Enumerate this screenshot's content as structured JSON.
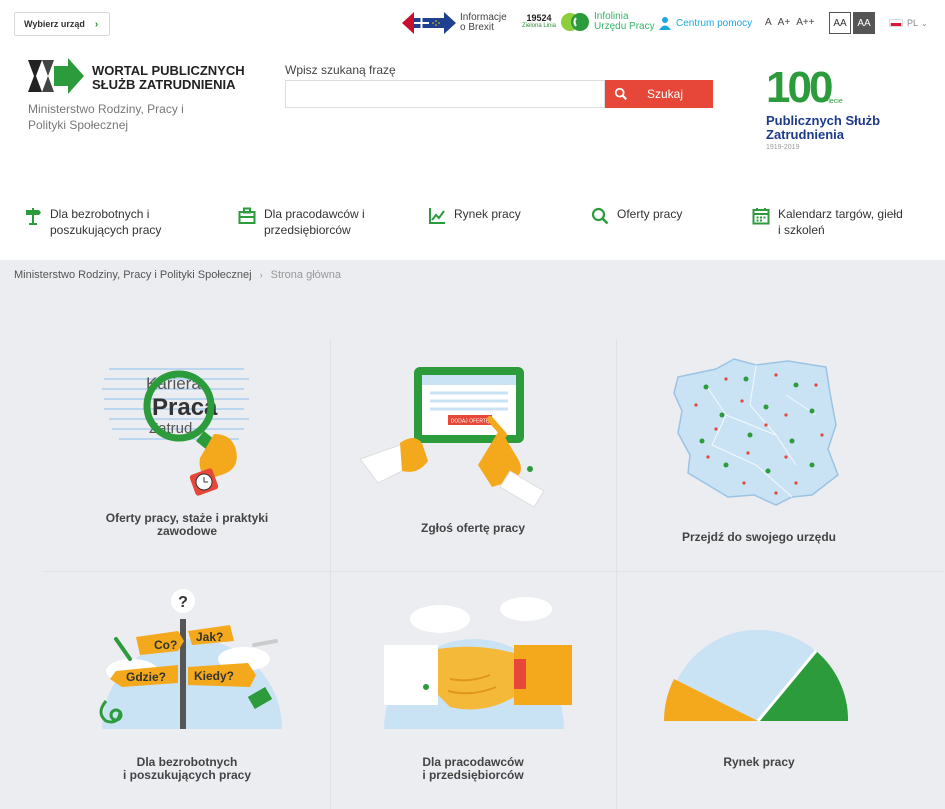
{
  "topbar": {
    "choose_office": "Wybierz urząd",
    "brexit_line1": "Informacje",
    "brexit_line2": "o Brexit",
    "infolinia_number": "19524",
    "infolinia_sub": "Zielona Linia",
    "infolinia_line1": "Infolinia",
    "infolinia_line2": "Urzędu Pracy",
    "help": "Centrum pomocy",
    "font_small": "A",
    "font_medium": "A+",
    "font_large": "A++",
    "contrast_normal": "AA",
    "contrast_high": "AA",
    "language": "PL"
  },
  "header": {
    "logo_line1": "WORTAL PUBLICZNYCH",
    "logo_line2": "SŁUŻB ZATRUDNIENIA",
    "ministry_line1": "Ministerstwo Rodziny, Pracy i",
    "ministry_line2": "Polityki Społecznej",
    "search_label": "Wpisz szukaną frazę",
    "search_value": "",
    "search_button": "Szukaj",
    "anniv_number": "100",
    "anniv_suffix": "-lecie",
    "anniv_line1": "Publicznych Służb",
    "anniv_line2": "Zatrudnienia",
    "anniv_years": "1919-2019"
  },
  "nav": [
    {
      "line1": "Dla bezrobotnych i",
      "line2": "poszukujących pracy",
      "icon": "signpost-icon"
    },
    {
      "line1": "Dla pracodawców i",
      "line2": "przedsiębiorców",
      "icon": "briefcase-icon"
    },
    {
      "line1": "Rynek pracy",
      "line2": "",
      "icon": "chart-icon"
    },
    {
      "line1": "Oferty pracy",
      "line2": "",
      "icon": "search-icon"
    },
    {
      "line1": "Kalendarz targów, giełd",
      "line2": "i szkoleń",
      "icon": "calendar-icon"
    }
  ],
  "breadcrumb": {
    "root": "Ministerstwo Rodziny, Pracy i Polityki Społecznej",
    "current": "Strona główna"
  },
  "tiles": [
    {
      "line1": "Oferty pracy, staże i praktyki",
      "line2": "zawodowe",
      "art_word1": "Kariera",
      "art_word2": "Praca",
      "art_word3": "Zatrud"
    },
    {
      "line1": "Zgłoś ofertę pracy",
      "line2": "",
      "art_button": "DODAJ OFERTĘ"
    },
    {
      "line1": "Przejdź do swojego urzędu",
      "line2": ""
    },
    {
      "line1": "Dla bezrobotnych",
      "line2": "i poszukujących pracy",
      "sign1": "Co?",
      "sign2": "Jak?",
      "sign3": "Gdzie?",
      "sign4": "Kiedy?",
      "sign_q": "?"
    },
    {
      "line1": "Dla pracodawców",
      "line2": "i przedsiębiorców"
    },
    {
      "line1": "Rynek pracy",
      "line2": ""
    }
  ],
  "colors": {
    "accent_green": "#2c9b3c",
    "search_red": "#e64738",
    "navy": "#1e3b8a",
    "bg_gray": "#ebedf0"
  }
}
